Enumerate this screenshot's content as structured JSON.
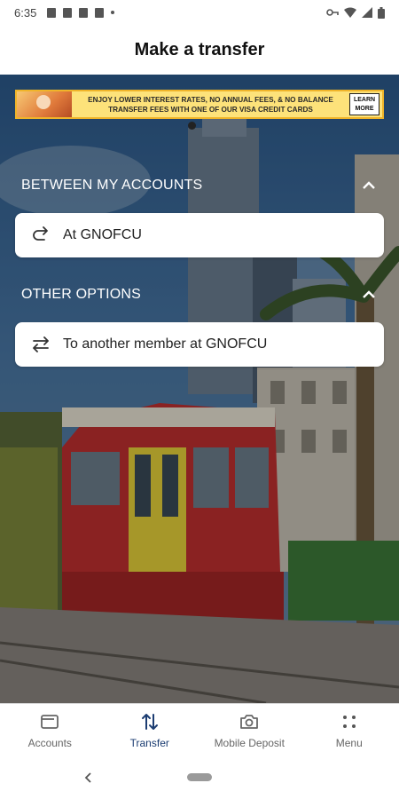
{
  "status_bar": {
    "time": "6:35"
  },
  "header": {
    "title": "Make a transfer"
  },
  "ad": {
    "text": "ENJOY LOWER INTEREST RATES, NO ANNUAL FEES, & NO BALANCE TRANSFER FEES WITH ONE OF OUR VISA CREDIT CARDS",
    "cta": "LEARN MORE"
  },
  "sections": [
    {
      "title": "BETWEEN MY ACCOUNTS",
      "options": [
        {
          "label": "At GNOFCU",
          "icon": "redo-arrow-icon"
        }
      ]
    },
    {
      "title": "OTHER OPTIONS",
      "options": [
        {
          "label": "To another member at GNOFCU",
          "icon": "swap-arrows-icon"
        }
      ]
    }
  ],
  "bottom_nav": {
    "items": [
      {
        "label": "Accounts",
        "icon": "wallet-icon",
        "active": false
      },
      {
        "label": "Transfer",
        "icon": "transfer-icon",
        "active": true
      },
      {
        "label": "Mobile Deposit",
        "icon": "camera-icon",
        "active": false
      },
      {
        "label": "Menu",
        "icon": "grid-dots-icon",
        "active": false
      }
    ]
  },
  "colors": {
    "active_nav": "#1c3d72",
    "section_text": "#ffffff"
  }
}
